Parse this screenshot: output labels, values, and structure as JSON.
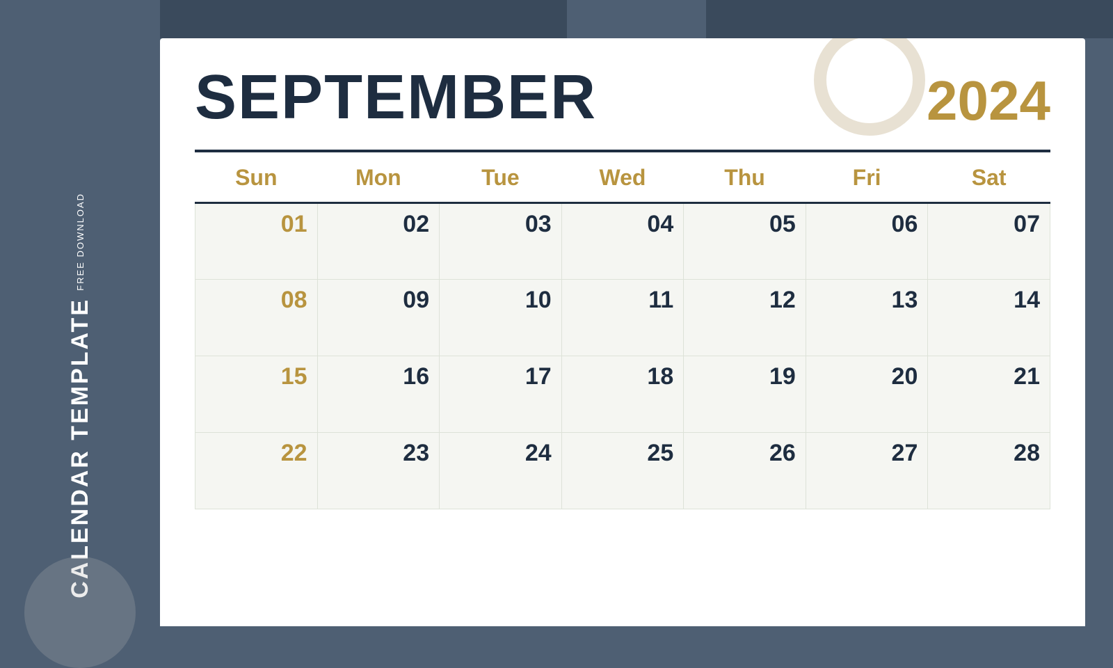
{
  "sidebar": {
    "free_download_label": "FREE DOWNLOAD",
    "calendar_template_label": "CALENDAR TEMPLATE"
  },
  "header": {
    "month": "SEPTEMBER",
    "year": "2024"
  },
  "days": {
    "headers": [
      "Sun",
      "Mon",
      "Tue",
      "Wed",
      "Thu",
      "Fri",
      "Sat"
    ]
  },
  "weeks": [
    [
      "01",
      "02",
      "03",
      "04",
      "05",
      "06",
      "07"
    ],
    [
      "08",
      "09",
      "10",
      "11",
      "12",
      "13",
      "14"
    ],
    [
      "15",
      "16",
      "17",
      "18",
      "19",
      "20",
      "21"
    ],
    [
      "22",
      "23",
      "24",
      "25",
      "26",
      "27",
      "28"
    ]
  ]
}
